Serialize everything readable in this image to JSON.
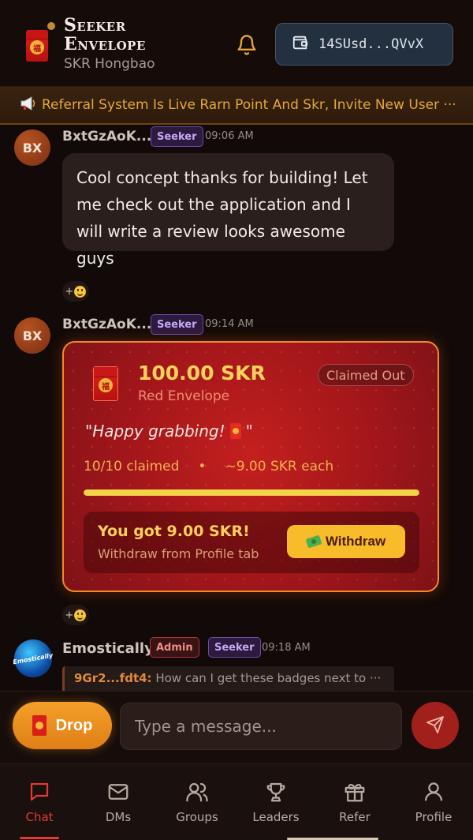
{
  "header": {
    "title_line1": "Seeker",
    "title_line2": "Envelope",
    "subtitle": "SKR Hongbao",
    "wallet_address": "14SUsd...QVvX",
    "icons": {
      "notifications": "bell-icon",
      "wallet": "wallet-icon",
      "logo": "red-envelope-icon"
    }
  },
  "announcement": {
    "icon": "megaphone-icon",
    "text": "Referral System Is Live Rarn Point And Skr, Invite New User ···"
  },
  "messages": [
    {
      "avatar_initials": "BX",
      "username": "BxtGzAoK...",
      "badges": [
        "Seeker"
      ],
      "time": "09:06 AM",
      "text": "Cool concept thanks for building! Let me check out the application and I will write a review looks awesome guys",
      "reaction_label": "+"
    },
    {
      "avatar_initials": "BX",
      "username": "BxtGzAoK...",
      "badges": [
        "Seeker"
      ],
      "time": "09:14 AM",
      "envelope": {
        "amount": "100.00 SKR",
        "type": "Red Envelope",
        "status": "Claimed Out",
        "message_open": "\"Happy grabbing!",
        "message_close": "\"",
        "claimed": "10/10 claimed",
        "separator": "•",
        "per_each": "~9.00 SKR each",
        "progress_fraction": 1.0,
        "got_title": "You got 9.00 SKR!",
        "got_subtitle": "Withdraw from Profile tab",
        "withdraw_label": "Withdraw"
      },
      "reaction_label": "+"
    },
    {
      "avatar_text": "Emostically",
      "username": "Emostically",
      "badges": [
        "Admin",
        "Seeker"
      ],
      "time": "09:18 AM",
      "reply_to": "9Gr2...fdt4:",
      "reply_text": "How can I get these badges next to ···"
    }
  ],
  "composer": {
    "drop_label": "Drop",
    "placeholder": "Type a message..."
  },
  "tabs": [
    {
      "label": "Chat",
      "icon": "chat-bubble-icon",
      "active": true
    },
    {
      "label": "DMs",
      "icon": "mail-icon",
      "active": false
    },
    {
      "label": "Groups",
      "icon": "users-icon",
      "active": false
    },
    {
      "label": "Leaders",
      "icon": "trophy-icon",
      "active": false
    },
    {
      "label": "Refer",
      "icon": "gift-icon",
      "active": false
    },
    {
      "label": "Profile",
      "icon": "user-icon",
      "active": false
    }
  ],
  "colors": {
    "accent_red": "#e23a35",
    "gold": "#ffd35b",
    "seeker_badge": "#c7a8f5",
    "admin_badge": "#f08a8a"
  }
}
